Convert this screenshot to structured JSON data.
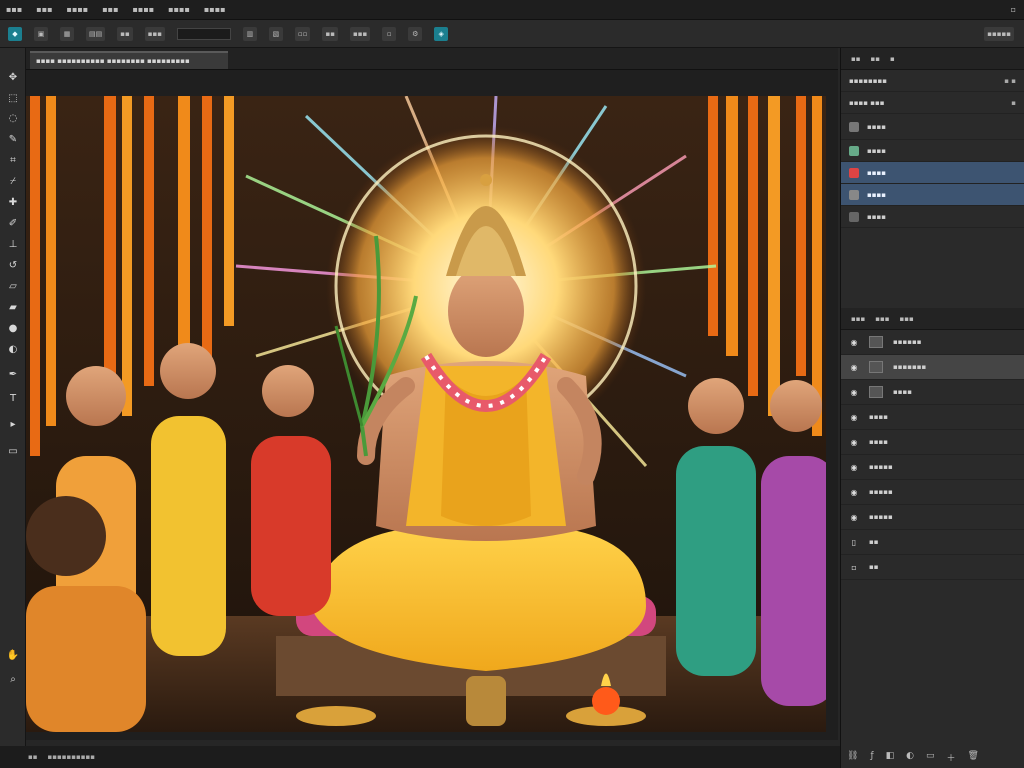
{
  "menu": [],
  "toolbar_tools": [
    "move-icon",
    "marquee-icon",
    "lasso-icon",
    "quick-select-icon",
    "crop-icon",
    "eyedropper-icon",
    "heal-icon",
    "brush-icon",
    "stamp-icon",
    "history-brush-icon",
    "eraser-icon",
    "gradient-icon",
    "blur-icon",
    "dodge-icon",
    "pen-icon",
    "type-icon",
    "path-select-icon",
    "shape-icon",
    "hand-icon",
    "zoom-icon"
  ],
  "colors": {
    "accent": "#1b7f8f",
    "selection": "#3d5471",
    "panel": "#2a2a2a",
    "saffron": "#ff8c1a",
    "gold": "#f2c230"
  },
  "canvas_image": "devotional-painting-seated-deity-with-halo-and-attendants"
}
